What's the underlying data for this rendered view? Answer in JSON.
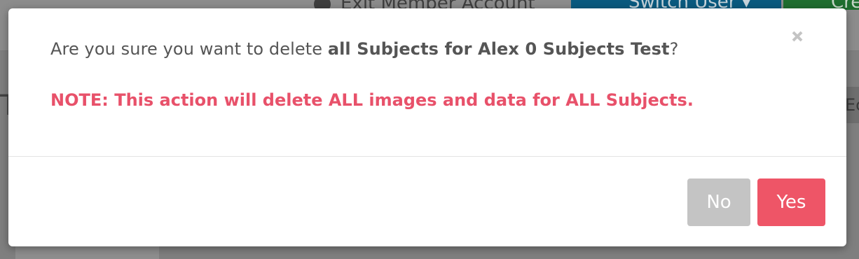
{
  "background": {
    "exit_label": "Exit Member Account",
    "switch_label": "Switch User ▾",
    "create_label": "Cre",
    "left_letter": "T",
    "right_label": "Ec"
  },
  "dialog": {
    "message_prefix": "Are you sure you want to delete ",
    "message_bold": "all Subjects for Alex 0 Subjects Test",
    "message_suffix": "?",
    "note": "NOTE: This action will delete ALL images and data for ALL Subjects.",
    "close_icon": "close-icon",
    "no_label": "No",
    "yes_label": "Yes"
  },
  "colors": {
    "note": "#e8516a",
    "yes_button": "#ee5567",
    "no_button": "#c4c4c4"
  }
}
